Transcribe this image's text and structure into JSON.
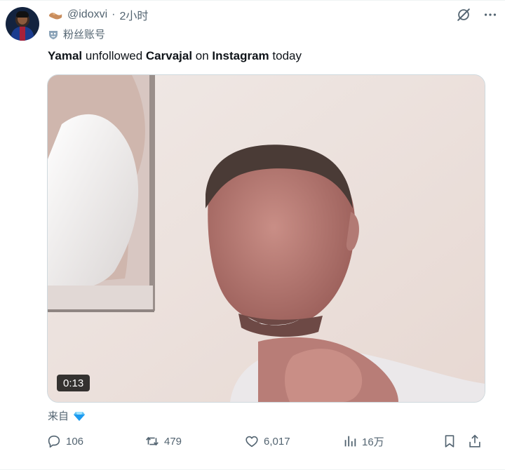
{
  "author": {
    "handle": "@idoxvi",
    "separator": "·",
    "time": "2小时",
    "fan_account_label": "粉丝账号"
  },
  "tweet": {
    "text_parts": [
      "Yamal",
      " unfollowed ",
      "Carvajal",
      " on ",
      "Instagram",
      " today"
    ]
  },
  "media": {
    "duration": "0:13"
  },
  "source_label": "来自",
  "actions": {
    "replies": "106",
    "retweets": "479",
    "likes": "6,017",
    "views": "16万"
  },
  "icons": [
    "handshake-icon",
    "mask-icon",
    "grok-slash-icon",
    "more-icon",
    "diamond-icon",
    "reply-icon",
    "retweet-icon",
    "like-icon",
    "views-icon",
    "bookmark-icon",
    "share-icon"
  ],
  "colors": {
    "muted_text": "#536471",
    "primary_text": "#0f1419",
    "border": "#cfd9de",
    "diamond": "#1d9bf0"
  }
}
